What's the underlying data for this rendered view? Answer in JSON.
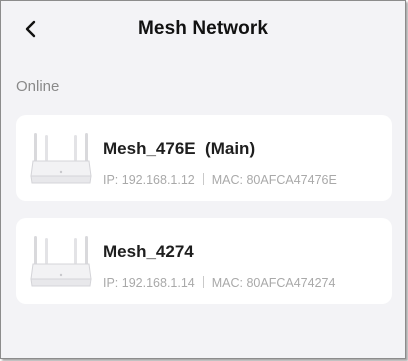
{
  "header": {
    "title": "Mesh Network",
    "back_icon": "chevron-left-icon"
  },
  "section": {
    "label": "Online"
  },
  "devices": [
    {
      "name": "Mesh_476E  (Main)",
      "ip": "IP: 192.168.1.12",
      "mac": "MAC: 80AFCA47476E",
      "icon": "mesh-router-icon"
    },
    {
      "name": "Mesh_4274",
      "ip": "IP: 192.168.1.14",
      "mac": "MAC: 80AFCA474274",
      "icon": "mesh-router-icon"
    }
  ],
  "colors": {
    "background": "#f3f3f6",
    "card": "#ffffff",
    "title_text": "#111111",
    "secondary_text": "#a9a9a9"
  }
}
